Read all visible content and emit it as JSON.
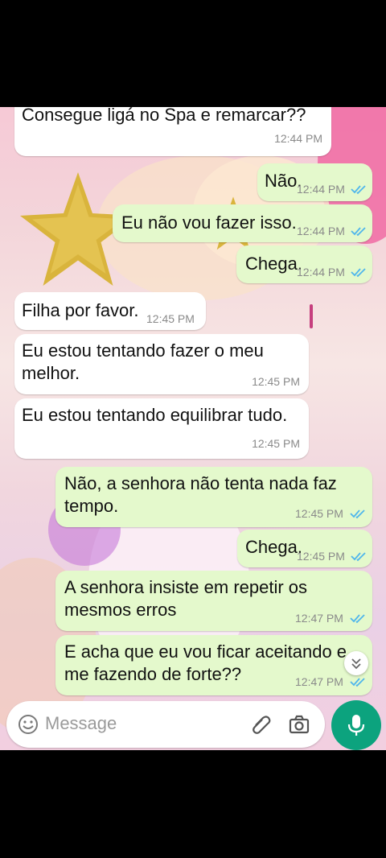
{
  "messages": [
    {
      "dir": "in",
      "text": "Consegue ligá no Spa e remarcar??",
      "time": "12:44 PM"
    },
    {
      "dir": "out",
      "text": "Não.",
      "time": "12:44 PM"
    },
    {
      "dir": "out",
      "text": "Eu não vou fazer isso.",
      "time": "12:44 PM"
    },
    {
      "dir": "out",
      "text": "Chega.",
      "time": "12:44 PM"
    },
    {
      "dir": "in",
      "text": "Filha por favor.",
      "time": "12:45 PM"
    },
    {
      "dir": "in",
      "text": "Eu estou tentando fazer o meu",
      "text2": "melhor.",
      "time": "12:45 PM"
    },
    {
      "dir": "in",
      "text": "Eu estou tentando equilibrar tudo.",
      "time": "12:45 PM"
    },
    {
      "dir": "out",
      "text": "Não, a senhora não tenta nada faz",
      "text2": "tempo.",
      "time": "12:45 PM"
    },
    {
      "dir": "out",
      "text": "Chega.",
      "time": "12:45 PM"
    },
    {
      "dir": "out",
      "text": "A senhora insiste em repetir os",
      "text2": "mesmos erros",
      "time": "12:47 PM"
    },
    {
      "dir": "out",
      "text": "E acha que eu vou ficar aceitando e",
      "text2": "me fazendo de forte??",
      "time": "12:47 PM"
    }
  ],
  "composer": {
    "placeholder": "Message"
  },
  "colors": {
    "outgoing": "#e4f9cc",
    "incoming": "#ffffff",
    "ticks": "#4fb6ec",
    "mic": "#0ca37e"
  },
  "icons": [
    "emoji-icon",
    "attach-icon",
    "camera-icon",
    "mic-icon",
    "scroll-down-icon",
    "read-ticks-icon"
  ]
}
